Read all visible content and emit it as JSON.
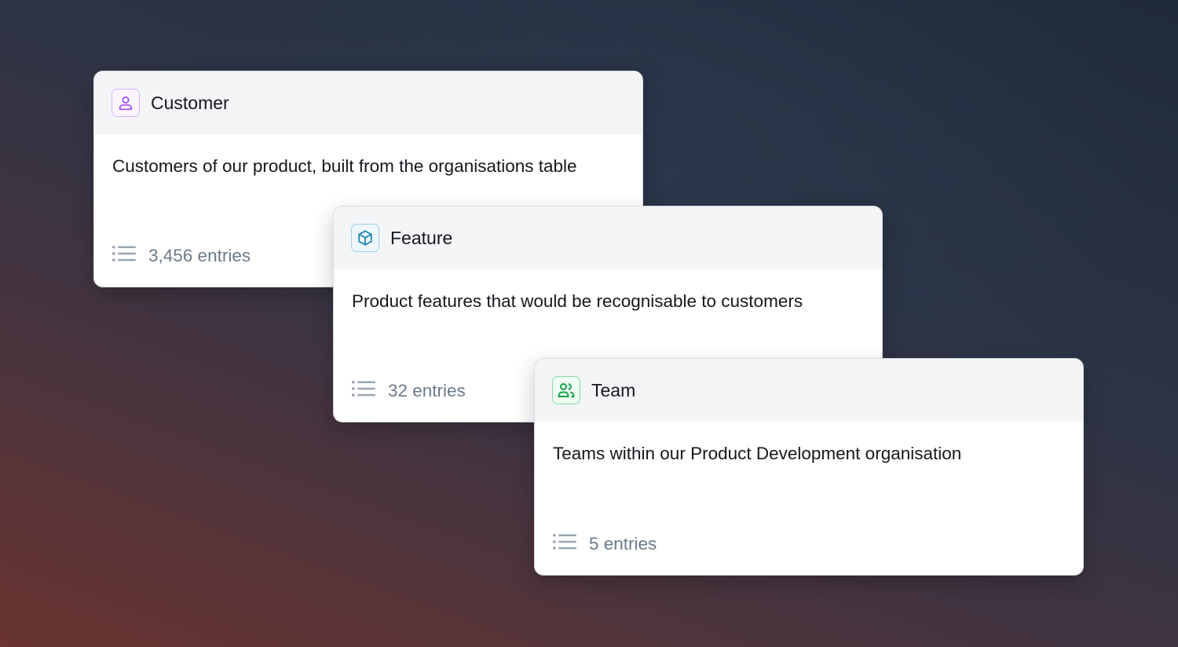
{
  "cards": [
    {
      "title": "Customer",
      "icon": "person-icon",
      "accent": "#a855f7",
      "description": "Customers of our product, built from the organisations table",
      "entries": "3,456 entries"
    },
    {
      "title": "Feature",
      "icon": "cube-icon",
      "accent": "#1e88b4",
      "description": "Product features that would be recognisable to customers",
      "entries": "32 entries"
    },
    {
      "title": "Team",
      "icon": "people-icon",
      "accent": "#16a34a",
      "description": "Teams within our Product Development organisation",
      "entries": "5 entries"
    }
  ],
  "list_icon": "list-icon",
  "entries_color": "#6b7b8c"
}
